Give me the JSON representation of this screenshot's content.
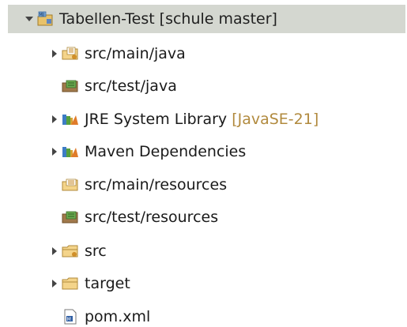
{
  "project": {
    "name": "Tabellen-Test",
    "decoration": "[schule master]",
    "icon": "maven-project-icon",
    "expanded": true
  },
  "items": [
    {
      "label": "src/main/java",
      "decoration": "",
      "icon": "source-folder-modified-icon",
      "expandable": true
    },
    {
      "label": "src/test/java",
      "decoration": "",
      "icon": "source-folder-icon",
      "expandable": false
    },
    {
      "label": "JRE System Library",
      "decoration": "[JavaSE-21]",
      "icon": "library-icon",
      "expandable": true
    },
    {
      "label": "Maven Dependencies",
      "decoration": "",
      "icon": "library-icon",
      "expandable": true
    },
    {
      "label": "src/main/resources",
      "decoration": "",
      "icon": "resource-folder-icon",
      "expandable": false
    },
    {
      "label": "src/test/resources",
      "decoration": "",
      "icon": "source-folder-icon",
      "expandable": false
    },
    {
      "label": "src",
      "decoration": "",
      "icon": "folder-modified-icon",
      "expandable": true
    },
    {
      "label": "target",
      "decoration": "",
      "icon": "folder-icon",
      "expandable": true
    },
    {
      "label": "pom.xml",
      "decoration": "",
      "icon": "maven-xml-file-icon",
      "expandable": false
    }
  ],
  "colors": {
    "selection": "#d4d7d0",
    "decoration": "#b18a3e"
  }
}
